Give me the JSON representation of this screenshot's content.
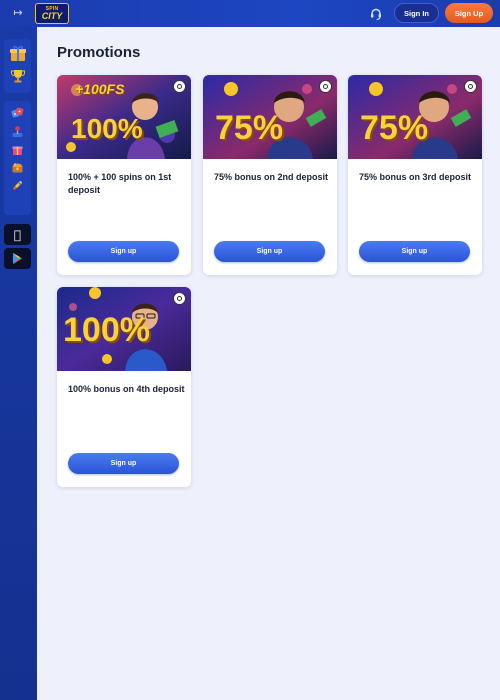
{
  "header": {
    "logo_top": "SPIN",
    "logo_bottom": "CITY",
    "signin_label": "Sign In",
    "signup_label": "Sign Up"
  },
  "sidebar": {
    "groups": [
      {
        "items": [
          {
            "icon": "gift-icon"
          },
          {
            "icon": "trophy-icon"
          }
        ]
      },
      {
        "items": [
          {
            "icon": "dice-icon"
          },
          {
            "icon": "joystick-icon"
          },
          {
            "icon": "present-icon"
          },
          {
            "icon": "treasure-icon"
          },
          {
            "icon": "rocket-icon"
          }
        ]
      }
    ],
    "apps": [
      {
        "icon": "apple-icon"
      },
      {
        "icon": "google-play-icon"
      }
    ]
  },
  "main": {
    "title": "Promotions",
    "promos": [
      {
        "badge": "100%",
        "badge_extra": "+100FS",
        "title": "100% + 100 spins on 1st deposit",
        "button": "Sign up"
      },
      {
        "badge": "75%",
        "badge_extra": "",
        "title": "75% bonus on 2nd deposit",
        "button": "Sign up"
      },
      {
        "badge": "75%",
        "badge_extra": "",
        "title": "75% bonus on 3rd deposit",
        "button": "Sign up"
      },
      {
        "badge": "100%",
        "badge_extra": "",
        "title": "100% bonus on 4th deposit",
        "button": "Sign up"
      }
    ]
  },
  "colors": {
    "header_bg": "#1d46c2",
    "signup_orange": "#e45a1e",
    "button_blue": "#2a54d6",
    "badge_gold": "#f5c52a",
    "page_bg": "#eef1fb"
  }
}
